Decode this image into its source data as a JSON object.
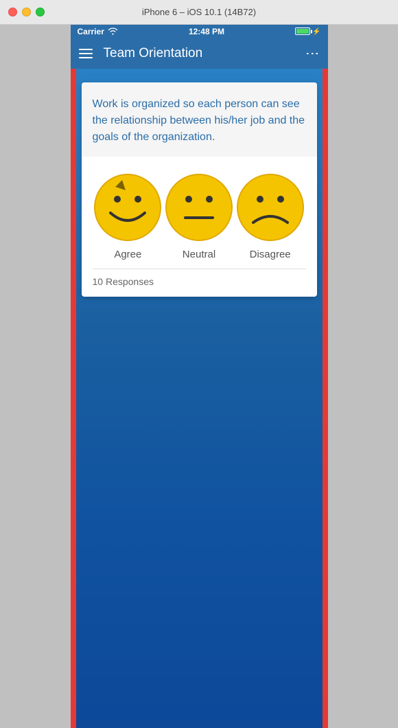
{
  "mac_chrome": {
    "title": "iPhone 6 – iOS 10.1 (14B72)"
  },
  "status_bar": {
    "carrier": "Carrier",
    "time": "12:48 PM"
  },
  "app_bar": {
    "title": "Team Orientation"
  },
  "card": {
    "question": "Work is organized so each person can see the relationship between his/her job and the goals of the organization.",
    "options": [
      {
        "label": "Agree",
        "type": "happy"
      },
      {
        "label": "Neutral",
        "type": "neutral"
      },
      {
        "label": "Disagree",
        "type": "sad"
      }
    ],
    "responses_label": "10 Responses"
  }
}
